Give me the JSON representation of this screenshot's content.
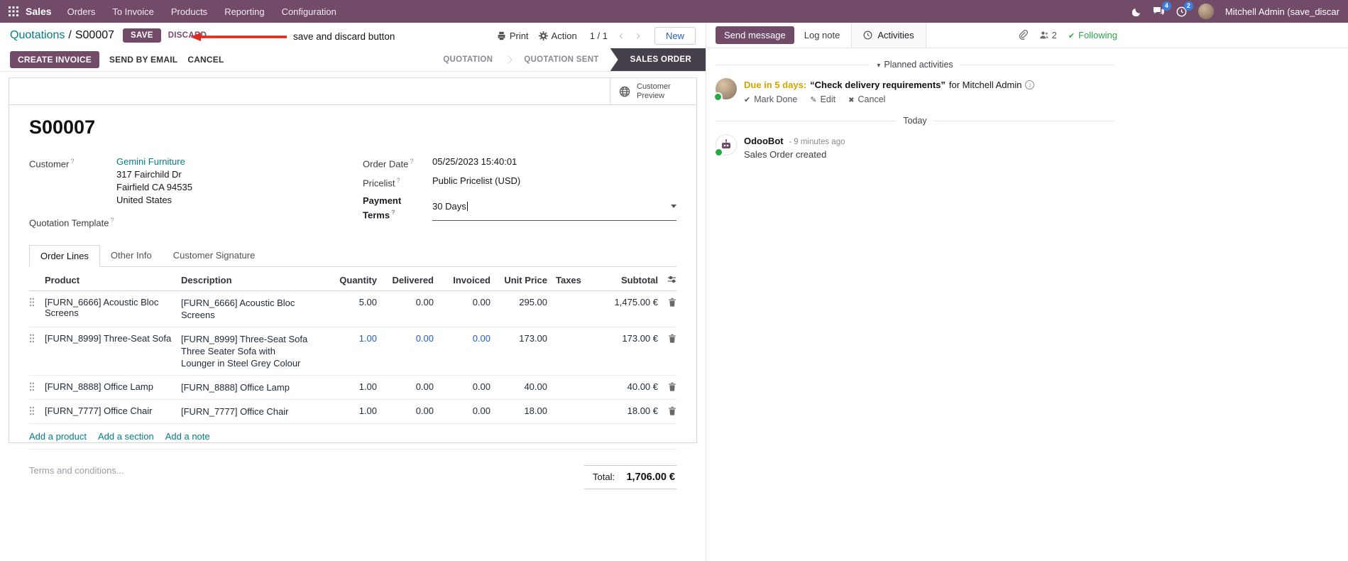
{
  "colors": {
    "brand": "#714B67",
    "link": "#017e84",
    "accent-blue": "#2160c4",
    "status-active": "#454049",
    "due-orange": "#d4a302",
    "green": "#28a745",
    "badge-blue": "#3b7ddd",
    "annotation-red": "#e2281e"
  },
  "nav": {
    "app_name": "Sales",
    "menus": [
      "Orders",
      "To Invoice",
      "Products",
      "Reporting",
      "Configuration"
    ],
    "chat_badge": "4",
    "clock_badge": "2",
    "user_name": "Mitchell Admin (save_discar"
  },
  "breadcrumb": {
    "parent": "Quotations",
    "separator": "/",
    "current": "S00007",
    "save_label": "SAVE",
    "discard_label": "DISCARD"
  },
  "annotation": {
    "label": "save and discard button"
  },
  "controls": {
    "print_label": "Print",
    "action_label": "Action",
    "pager": "1 / 1",
    "new_label": "New"
  },
  "statusbar": {
    "create_invoice": "CREATE INVOICE",
    "send_by_email": "SEND BY EMAIL",
    "cancel": "CANCEL",
    "steps": [
      {
        "label": "QUOTATION"
      },
      {
        "label": "QUOTATION SENT"
      },
      {
        "label": "SALES ORDER"
      }
    ]
  },
  "sheet": {
    "preview_line1": "Customer",
    "preview_line2": "Preview",
    "title": "S00007",
    "help_marker": "?",
    "customer_label": "Customer",
    "customer_name": "Gemini Furniture",
    "address": [
      "317 Fairchild Dr",
      "Fairfield CA 94535",
      "United States"
    ],
    "quotation_template_label": "Quotation Template",
    "order_date_label": "Order Date",
    "order_date_value": "05/25/2023 15:40:01",
    "pricelist_label": "Pricelist",
    "pricelist_value": "Public Pricelist (USD)",
    "payment_terms_label": "Payment Terms",
    "payment_terms_value": "30 Days"
  },
  "tabs": [
    {
      "label": "Order Lines"
    },
    {
      "label": "Other Info"
    },
    {
      "label": "Customer Signature"
    }
  ],
  "table": {
    "headers": {
      "product": "Product",
      "description": "Description",
      "quantity": "Quantity",
      "delivered": "Delivered",
      "invoiced": "Invoiced",
      "unit_price": "Unit Price",
      "taxes": "Taxes",
      "subtotal": "Subtotal"
    },
    "rows": [
      {
        "product": "[FURN_6666] Acoustic Bloc Screens",
        "desc": [
          "[FURN_6666] Acoustic Bloc Screens"
        ],
        "quantity": "5.00",
        "delivered": "0.00",
        "invoiced": "0.00",
        "unit_price": "295.00",
        "subtotal": "1,475.00 €"
      },
      {
        "product": "[FURN_8999] Three-Seat Sofa",
        "desc": [
          "[FURN_8999] Three-Seat Sofa",
          "Three Seater Sofa with Lounger in Steel Grey Colour"
        ],
        "quantity": "1.00",
        "delivered": "0.00",
        "invoiced": "0.00",
        "unit_price": "173.00",
        "subtotal": "173.00 €"
      },
      {
        "product": "[FURN_8888] Office Lamp",
        "desc": [
          "[FURN_8888] Office Lamp"
        ],
        "quantity": "1.00",
        "delivered": "0.00",
        "invoiced": "0.00",
        "unit_price": "40.00",
        "subtotal": "40.00 €"
      },
      {
        "product": "[FURN_7777] Office Chair",
        "desc": [
          "[FURN_7777] Office Chair"
        ],
        "quantity": "1.00",
        "delivered": "0.00",
        "invoiced": "0.00",
        "unit_price": "18.00",
        "subtotal": "18.00 €"
      }
    ],
    "add_product": "Add a product",
    "add_section": "Add a section",
    "add_note": "Add a note",
    "terms_placeholder": "Terms and conditions...",
    "total_label": "Total:",
    "total_value": "1,706.00 €"
  },
  "chatter": {
    "send_message": "Send message",
    "log_note": "Log note",
    "activities_tab": "Activities",
    "followers_count": "2",
    "following": "Following",
    "planned_header": "Planned activities",
    "activity": {
      "due": "Due in 5 days:",
      "summary": "“Check delivery requirements”",
      "assignee": "for Mitchell Admin",
      "mark_done": "Mark Done",
      "edit": "Edit",
      "cancel": "Cancel"
    },
    "today_divider": "Today",
    "message": {
      "author": "OdooBot",
      "timestamp": "- 9 minutes ago",
      "body": "Sales Order created"
    }
  }
}
